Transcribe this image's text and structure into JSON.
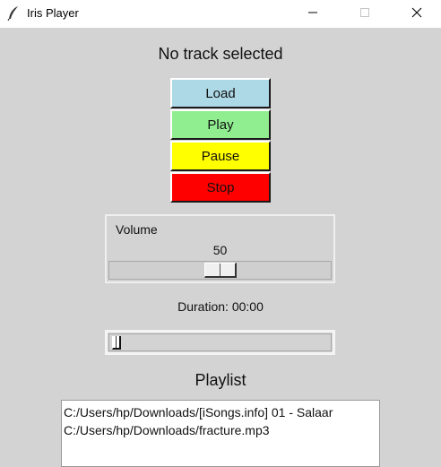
{
  "window": {
    "title": "Iris Player",
    "icon": "feather-icon",
    "controls": [
      "minimize-icon",
      "maximize-icon",
      "close-icon"
    ]
  },
  "track": {
    "title": "No track selected"
  },
  "controls": {
    "load": {
      "label": "Load",
      "color": "#add8e6"
    },
    "play": {
      "label": "Play",
      "color": "#90ee90"
    },
    "pause": {
      "label": "Pause",
      "color": "#ffff00"
    },
    "stop": {
      "label": "Stop",
      "color": "#ff0000"
    }
  },
  "volume": {
    "label": "Volume",
    "value": "50",
    "min": 0,
    "max": 100
  },
  "duration": {
    "text": "Duration: 00:00"
  },
  "progress": {
    "value": 0
  },
  "playlist": {
    "label": "Playlist",
    "items": [
      "C:/Users/hp/Downloads/[iSongs.info] 01 - Salaar",
      "C:/Users/hp/Downloads/fracture.mp3"
    ]
  }
}
